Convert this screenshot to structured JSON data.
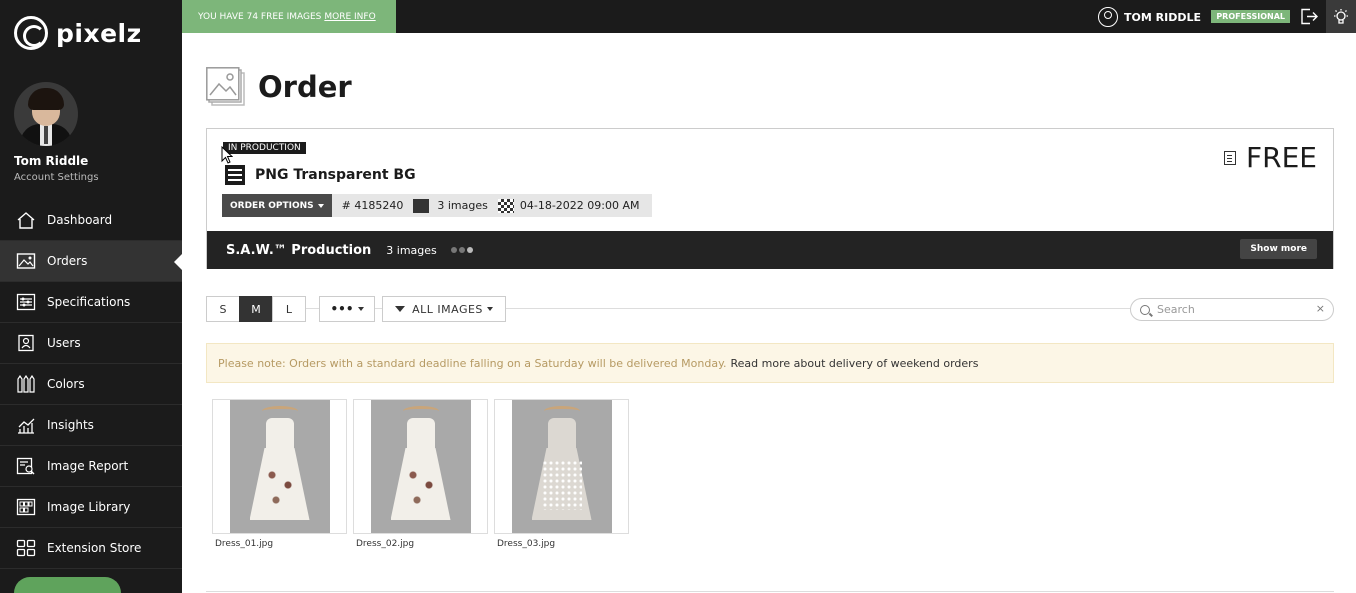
{
  "brand": {
    "name": "pixelz"
  },
  "topbar": {
    "free_banner_text": "YOU HAVE 74 FREE IMAGES",
    "free_banner_link": "MORE INFO",
    "user_name": "TOM RIDDLE",
    "plan_badge": "PROFESSIONAL",
    "icons": {
      "user": "user-circle-icon",
      "logout": "logout-icon",
      "theme": "lightbulb-icon"
    }
  },
  "sidebar": {
    "user_name": "Tom Riddle",
    "account_settings": "Account Settings",
    "items": [
      {
        "label": "Dashboard",
        "icon": "home-icon",
        "active": false
      },
      {
        "label": "Orders",
        "icon": "orders-icon",
        "active": true
      },
      {
        "label": "Specifications",
        "icon": "sliders-icon",
        "active": false
      },
      {
        "label": "Users",
        "icon": "users-icon",
        "active": false
      },
      {
        "label": "Colors",
        "icon": "colors-icon",
        "active": false
      },
      {
        "label": "Insights",
        "icon": "insights-icon",
        "active": false
      },
      {
        "label": "Image Report",
        "icon": "image-report-icon",
        "active": false
      },
      {
        "label": "Image Library",
        "icon": "image-library-icon",
        "active": false
      },
      {
        "label": "Extension Store",
        "icon": "extension-store-icon",
        "active": false
      }
    ]
  },
  "page": {
    "title": "Order"
  },
  "order": {
    "status": "IN PRODUCTION",
    "product_name": "PNG Transparent BG",
    "price": "FREE",
    "order_options_label": "ORDER OPTIONS",
    "order_number": "# 4185240",
    "image_count": "3 images",
    "deadline": "04-18-2022 09:00 AM",
    "production_title": "S.A.W.™ Production",
    "production_count": "3 images",
    "show_more_label": "Show more"
  },
  "toolbar": {
    "sizes": [
      "S",
      "M",
      "L"
    ],
    "active_size": "M",
    "more_label": "•••",
    "filter_label": "ALL IMAGES",
    "search_placeholder": "Search",
    "search_value": "",
    "clear_label": "×"
  },
  "notice": {
    "text": "Please note: Orders with a standard deadline falling on a Saturday will be delivered Monday.",
    "link": "Read more about delivery of weekend orders"
  },
  "images": [
    {
      "name": "Dress_01.jpg"
    },
    {
      "name": "Dress_02.jpg"
    },
    {
      "name": "Dress_03.jpg"
    }
  ],
  "colors": {
    "sidebar_bg": "#1b1b1b",
    "accent_green": "#7db67a",
    "notice_bg": "#fcf6e6"
  }
}
